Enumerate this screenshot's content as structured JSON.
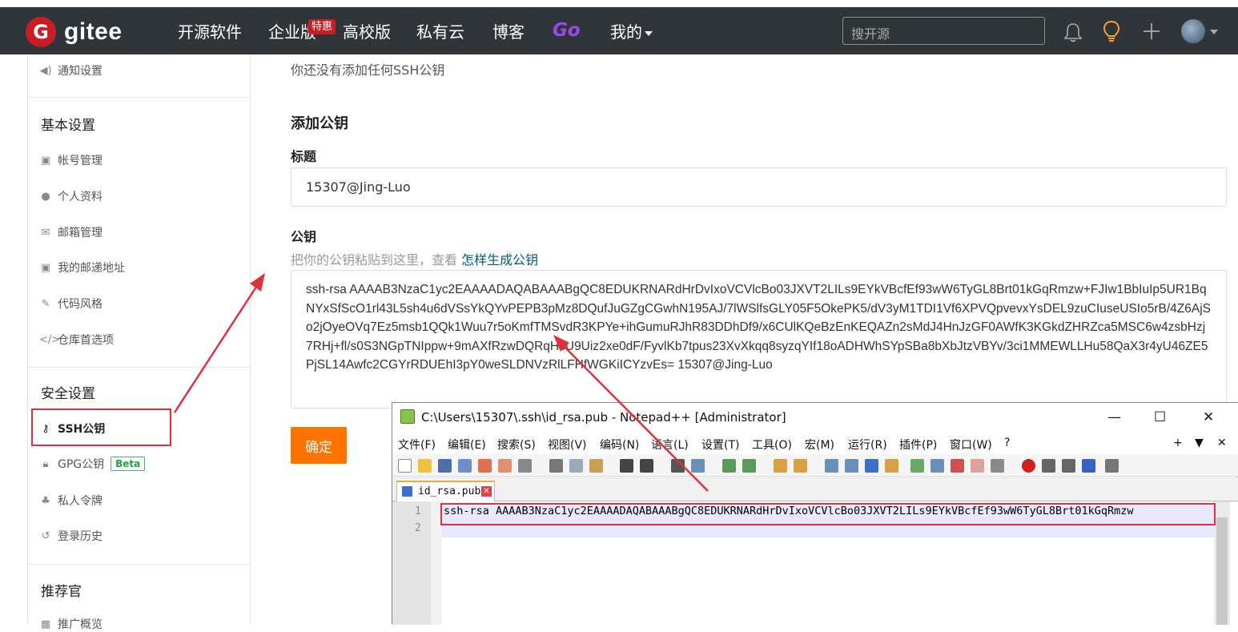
{
  "nav": {
    "brand": "gitee",
    "logo_letter": "G",
    "links": [
      "开源软件",
      "企业版",
      "高校版",
      "私有云",
      "博客",
      "Go",
      "我的"
    ],
    "hot_badge": "特惠",
    "search_placeholder": "搜开源",
    "icons": [
      "bell-icon",
      "bulb-icon",
      "plus-icon",
      "avatar"
    ]
  },
  "sidebar": {
    "notify": "通知设置",
    "basic_heading": "基本设置",
    "basic_items": [
      "帐号管理",
      "个人资料",
      "邮箱管理",
      "我的邮递地址",
      "代码风格",
      "仓库首选项"
    ],
    "security_heading": "安全设置",
    "security_items": [
      "SSH公钥",
      "GPG公钥",
      "私人令牌",
      "登录历史"
    ],
    "beta": "Beta",
    "recommend_heading": "推荐官",
    "recommend_item": "推广概览"
  },
  "main": {
    "no_key_note": "你还没有添加任何SSH公钥",
    "add_heading": "添加公钥",
    "title_label": "标题",
    "title_value": "15307@Jing-Luo",
    "key_label": "公钥",
    "key_hint": "把你的公钥粘贴到这里，查看",
    "key_hint_link": "怎样生成公钥",
    "key_value": "ssh-rsa AAAAB3NzaC1yc2EAAAADAQABAAABgQC8EDUKRNARdHrDvIxoVCVlcBo03JXVT2LILs9EYkVBcfEf93wW6TyGL8Brt01kGqRmzw+FJIw1BbIuIp5UR1BqNYxSfScO1rl43L5sh4u6dVSsYkQYvPEPB3pMz8DQufJuGZgCGwhN195AJ/7lWSlfsGLY05F5OkePK5/dV3yM1TDI1Vf6XPVQpvevxYsDEL9zuCIuseUSIo5rB/4Z6AjSo2jOyeOVq7Ez5msb1QQk1Wuu7r5oKmfTMSvdR3KPYe+ihGumuRJhR83DDhDf9/x6CUlKQeBzEnKEQAZn2sMdJ4HnJzGF0AWfK3KGkdZHRZca5MSC6w4zsbHzj7RHj+fl/s0S3NGpTNIppw+9mAXfRzwDQRqHcU9Uiz2xe0dF/FyvlKb7tpus23XvXkqq8syzqYIf18oADHWhSYpSBa8bXbJtzVBYv/3ci1MMEWLLHu58QaX3r4yU46ZE5PjSL14Awfc2CGYrRDUEhI3pY0weSLDNVzRlLFHfWGKiICYzvEs= 15307@Jing-Luo",
    "confirm_button": "确定"
  },
  "notepad": {
    "title": "C:\\Users\\15307\\.ssh\\id_rsa.pub - Notepad++ [Administrator]",
    "menus": [
      "文件(F)",
      "编辑(E)",
      "搜索(S)",
      "视图(V)",
      "编码(N)",
      "语言(L)",
      "设置(T)",
      "工具(O)",
      "宏(M)",
      "运行(R)",
      "插件(P)",
      "窗口(W)",
      "?"
    ],
    "menu_right": [
      "+",
      "▼",
      "✕"
    ],
    "tab_name": "id_rsa.pub",
    "line_numbers": [
      "1",
      "2"
    ],
    "line1": "ssh-rsa AAAAB3NzaC1yc2EAAAADAQABAAABgQC8EDUKRNARdHrDvIxoVCVlcBo03JXVT2LILs9EYkVBcfEf93wW6TyGL8Brt01kGqRmzw",
    "window_buttons": [
      "—",
      "☐",
      "✕"
    ]
  },
  "colors": {
    "nav_bg": "#2f3538",
    "brand_red": "#c71d23",
    "confirm_orange": "#fe7300",
    "annotation_red": "#e0303c",
    "go_purple": "#9a49ea"
  }
}
